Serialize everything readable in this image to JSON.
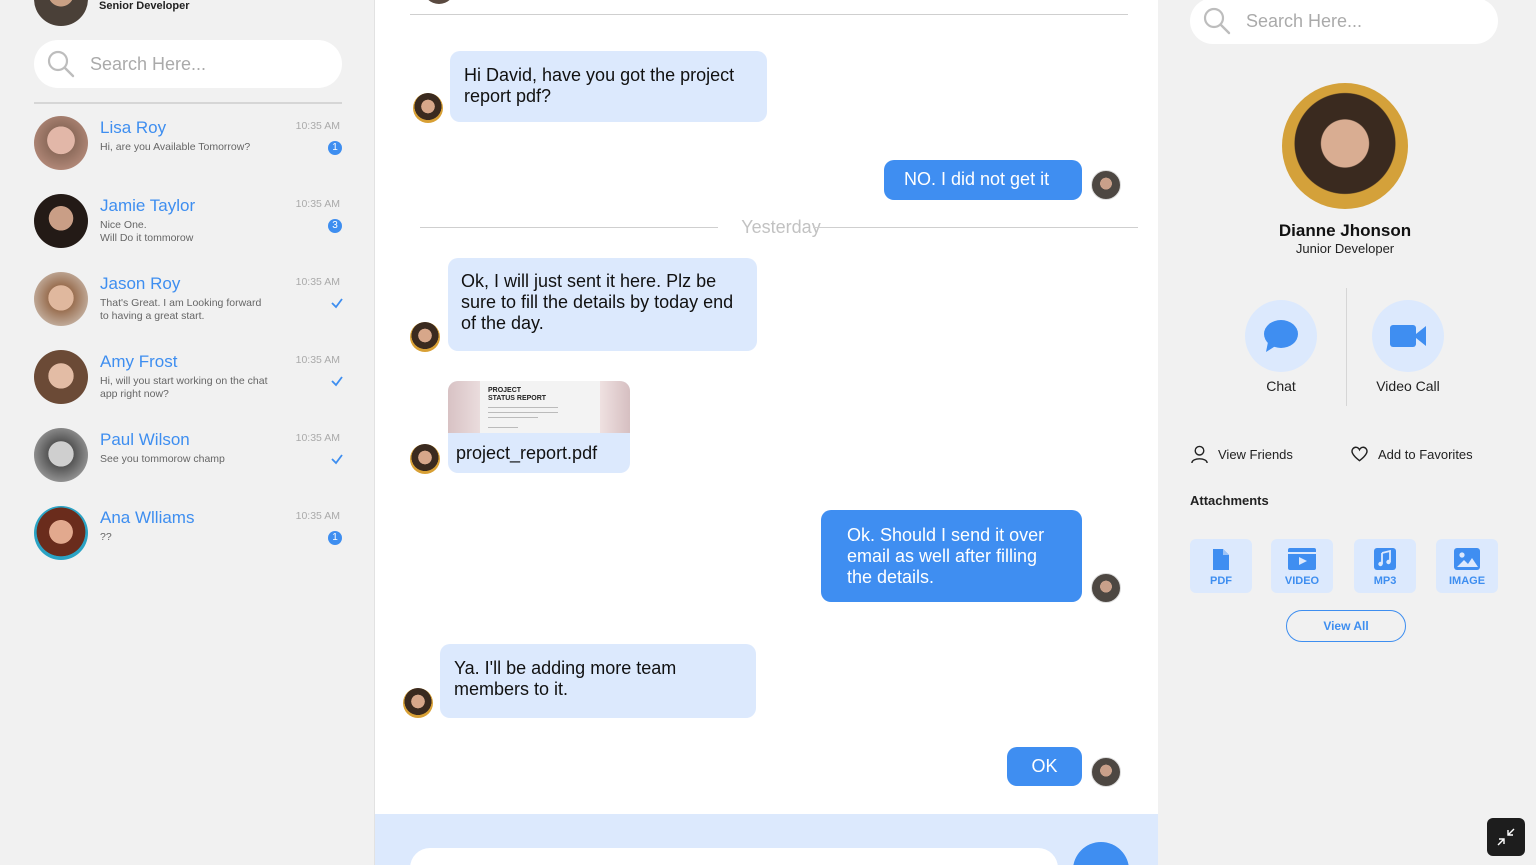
{
  "current_user": {
    "role": "Senior Developer"
  },
  "left_search": {
    "placeholder": "Search Here..."
  },
  "contacts": [
    {
      "name": "Lisa Roy",
      "message": "Hi, are you Available Tomorrow?",
      "time": "10:35 AM",
      "badge": "1",
      "status": "unread"
    },
    {
      "name": "Jamie Taylor",
      "message": "Nice One.\nWill Do it tommorow",
      "time": "10:35 AM",
      "badge": "3",
      "status": "unread"
    },
    {
      "name": "Jason Roy",
      "message": "That's Great. I am Looking forward to having a great start.",
      "time": "10:35 AM",
      "status": "read"
    },
    {
      "name": "Amy Frost",
      "message": "Hi, will you start working on the chat app right now?",
      "time": "10:35 AM",
      "status": "read"
    },
    {
      "name": "Paul Wilson",
      "message": "See you tommorow champ",
      "time": "10:35 AM",
      "status": "read"
    },
    {
      "name": "Ana Wlliams",
      "message": "??",
      "time": "10:35 AM",
      "badge": "1",
      "status": "unread"
    }
  ],
  "chat": {
    "messages": [
      {
        "direction": "incoming",
        "text": "Hi David, have you got the project report pdf?"
      },
      {
        "direction": "outgoing",
        "text": "NO. I did not get it"
      },
      {
        "direction": "incoming",
        "text": "Ok, I will just sent it here. Plz be sure to fill the details by today end of the day."
      },
      {
        "direction": "outgoing",
        "text": "Ok. Should I send it over email as well after filling the details."
      },
      {
        "direction": "incoming",
        "text": "Ya. I'll be adding more team members to it."
      },
      {
        "direction": "outgoing",
        "text": "OK"
      }
    ],
    "date_separator": "Yesterday",
    "attachment": {
      "file_name": "project_report.pdf",
      "preview_title": "PROJECT\nSTATUS REPORT"
    }
  },
  "right_search": {
    "placeholder": "Search Here..."
  },
  "profile": {
    "name": "Dianne Jhonson",
    "role": "Junior Developer",
    "actions": {
      "chat": "Chat",
      "video_call": "Video Call"
    },
    "links": {
      "view_friends": "View Friends",
      "add_favorites": "Add to Favorites"
    },
    "attachments_title": "Attachments",
    "attachment_types": [
      "PDF",
      "VIDEO",
      "MP3",
      "IMAGE"
    ],
    "view_all": "View All"
  },
  "colors": {
    "accent": "#3f8ef1",
    "incoming_bubble": "#dce9fd",
    "panel_bg": "#f1f1f1"
  },
  "icons": [
    "search-icon",
    "check-icon",
    "chat-bubble-icon",
    "video-camera-icon",
    "user-icon",
    "heart-icon",
    "pdf-file-icon",
    "video-file-icon",
    "music-file-icon",
    "image-file-icon",
    "collapse-icon"
  ]
}
